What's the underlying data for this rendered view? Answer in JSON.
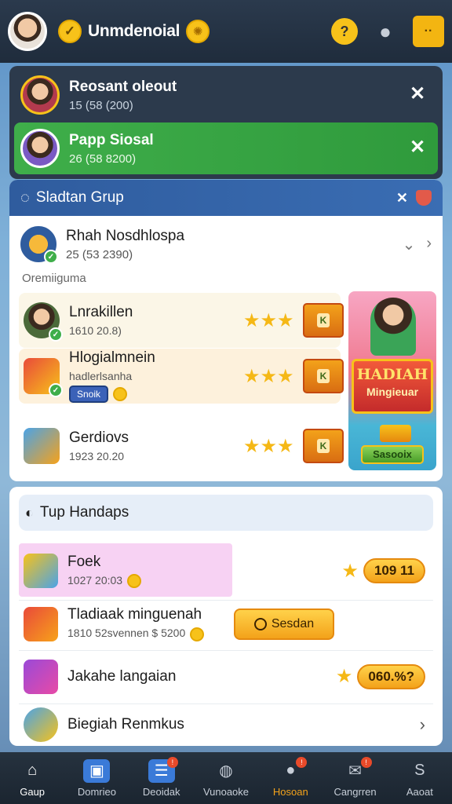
{
  "topbar": {
    "title": "Unmdenoial",
    "avatar_icon": "profile-avatar",
    "icons": [
      "check-coin-icon",
      "star-coin-icon",
      "help-icon",
      "person-icon",
      "menu-icon"
    ]
  },
  "notifications": [
    {
      "title": "Reosant oleout",
      "sub": "15 (58 (200)"
    },
    {
      "title": "Papp Siosal",
      "sub": "26 (58 8200)"
    }
  ],
  "group": {
    "header_title": "Sladtan Grup",
    "row_title": "Rhah Nosdhlospa",
    "row_sub": "25 (53 2390)",
    "section_label": "Oremiiguma",
    "rewards": [
      {
        "title": "Lnrakillen",
        "sub": "1610 20.8)",
        "gift_label": "K"
      },
      {
        "title": "Hlogialmnein",
        "sub": "hadlerlsanha",
        "badge": "Snoik",
        "gift_label": "K"
      },
      {
        "title": "Gerdiovs",
        "sub": "1923 20.20",
        "gift_label": "K"
      }
    ],
    "promo": {
      "title": "HADIAH",
      "subtitle": "Mingieuar",
      "button": "Sasooix"
    }
  },
  "top_list": {
    "header_title": "Tup Handaps",
    "rows": [
      {
        "title": "Foek",
        "sub": "1027 20:03",
        "value": "109 11"
      },
      {
        "title": "Tladiaak minguenah",
        "sub": "1810 52svennen $ 5200",
        "button": "Sesdan"
      },
      {
        "title": "Jakahe langaian",
        "value": "060.%?"
      },
      {
        "title": "Biegiah Renmkus"
      }
    ]
  },
  "bottom_nav": [
    {
      "label": "Gaup",
      "icon": "home-icon"
    },
    {
      "label": "Domrieo",
      "icon": "store-icon"
    },
    {
      "label": "Deoidak",
      "icon": "calendar-icon",
      "badge": "!"
    },
    {
      "label": "Vunoaoke",
      "icon": "chat-icon"
    },
    {
      "label": "Hosoan",
      "icon": "message-icon",
      "badge": "!"
    },
    {
      "label": "Cangrren",
      "icon": "mail-icon",
      "badge": "!"
    },
    {
      "label": "Aaoat",
      "icon": "settings-icon"
    }
  ],
  "colors": {
    "accent": "#f7c21a",
    "header_blue": "#2f5c9e",
    "green": "#3fae4a",
    "dark": "#1f2c3c"
  }
}
